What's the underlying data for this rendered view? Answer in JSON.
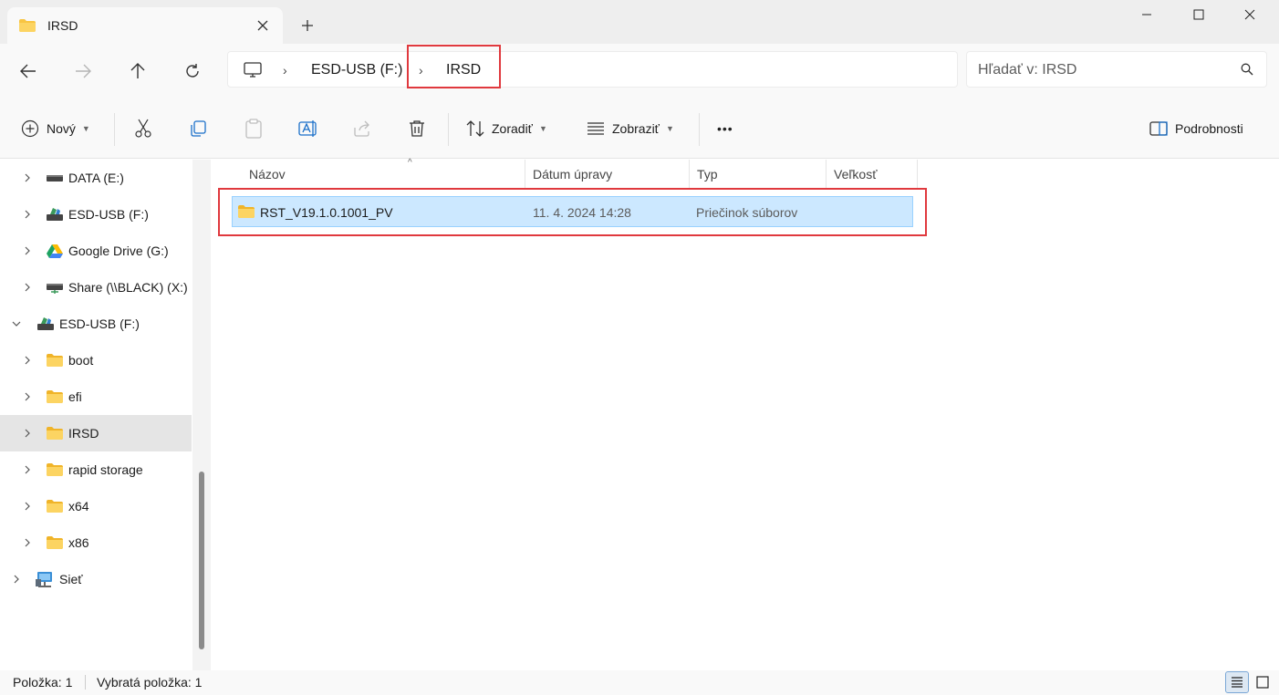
{
  "tab": {
    "title": "IRSD"
  },
  "window": {
    "minimize": "minimize",
    "maximize": "maximize",
    "close": "close"
  },
  "breadcrumb": {
    "items": [
      "ESD-USB (F:)",
      "IRSD"
    ]
  },
  "search": {
    "placeholder": "Hľadať v: IRSD"
  },
  "toolbar": {
    "new_label": "Nový",
    "sort_label": "Zoradiť",
    "view_label": "Zobraziť",
    "more_label": "•••",
    "details_label": "Podrobnosti"
  },
  "sidebar": {
    "items": [
      {
        "label": "DATA (E:)",
        "icon": "drive-icon"
      },
      {
        "label": "ESD-USB (F:)",
        "icon": "usb-drive-icon"
      },
      {
        "label": "Google Drive (G:)",
        "icon": "google-drive-icon"
      },
      {
        "label": "Share (\\\\BLACK) (X:)",
        "icon": "network-drive-icon"
      },
      {
        "label": "ESD-USB (F:)",
        "icon": "usb-drive-icon"
      },
      {
        "label": "boot",
        "icon": "folder-icon"
      },
      {
        "label": "efi",
        "icon": "folder-icon"
      },
      {
        "label": "IRSD",
        "icon": "folder-icon"
      },
      {
        "label": "rapid storage",
        "icon": "folder-icon"
      },
      {
        "label": "x64",
        "icon": "folder-icon"
      },
      {
        "label": "x86",
        "icon": "folder-icon"
      },
      {
        "label": "Sieť",
        "icon": "network-icon"
      }
    ]
  },
  "table": {
    "columns": [
      "Názov",
      "Dátum úpravy",
      "Typ",
      "Veľkosť"
    ],
    "rows": [
      {
        "name": "RST_V19.1.0.1001_PV",
        "date": "11. 4. 2024 14:28",
        "type": "Priečinok súborov",
        "size": ""
      }
    ]
  },
  "status": {
    "count": "Položka: 1",
    "selected": "Vybratá položka: 1"
  },
  "colors": {
    "selection": "#cce8ff",
    "highlight_box": "#e0393e",
    "folder": "#f8c542"
  }
}
